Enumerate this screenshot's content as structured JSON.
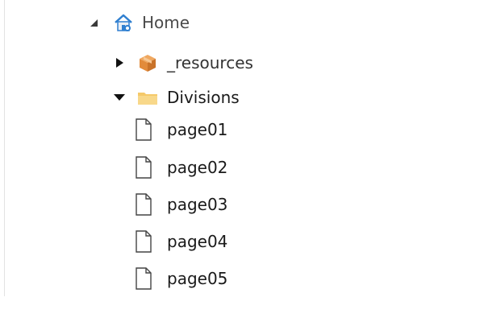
{
  "tree": {
    "root": {
      "label": "Home",
      "icon": "home-icon",
      "expanded": true
    },
    "children": [
      {
        "label": "_resources",
        "icon": "package-icon",
        "expanded": false
      },
      {
        "label": "Divisions",
        "icon": "folder-icon",
        "expanded": true,
        "children": [
          {
            "label": "page01",
            "icon": "file-icon"
          },
          {
            "label": "page02",
            "icon": "file-icon"
          },
          {
            "label": "page03",
            "icon": "file-icon"
          },
          {
            "label": "page04",
            "icon": "file-icon"
          },
          {
            "label": "page05",
            "icon": "file-icon"
          }
        ]
      }
    ]
  },
  "colors": {
    "folder": "#f5c96a",
    "package": "#e28b3b",
    "home_blue": "#2f7fd0"
  }
}
